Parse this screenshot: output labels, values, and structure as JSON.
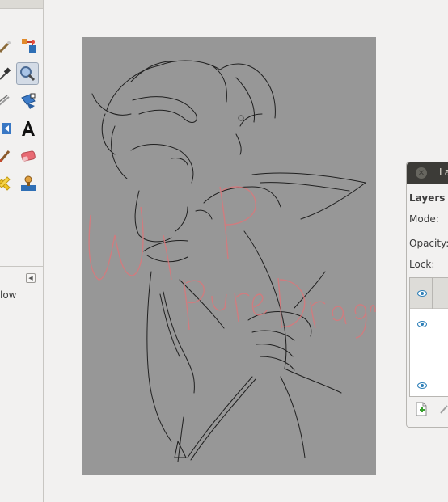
{
  "toolbox": {
    "tools": [
      {
        "name": "measure-tool",
        "icon": "ruler-icon"
      },
      {
        "name": "clone-tool",
        "icon": "clone-stamp-icon"
      },
      {
        "name": "color-picker-tool",
        "icon": "eyedropper-icon"
      },
      {
        "name": "zoom-tool",
        "icon": "magnifier-icon",
        "active": true
      },
      {
        "name": "crop-tool",
        "icon": "knife-icon"
      },
      {
        "name": "transform-tool",
        "icon": "transform-icon"
      },
      {
        "name": "flip-tool",
        "icon": "flip-icon"
      },
      {
        "name": "text-tool",
        "icon": "text-A-icon"
      },
      {
        "name": "paintbrush-tool",
        "icon": "paintbrush-icon"
      },
      {
        "name": "eraser-tool",
        "icon": "eraser-icon"
      },
      {
        "name": "heal-tool",
        "icon": "heal-icon"
      },
      {
        "name": "smudge-tool",
        "icon": "smudge-stamp-icon"
      }
    ],
    "tool_options_partial_text": "low"
  },
  "canvas": {
    "background": "#979797",
    "watermark": "WIP Pure Dragon",
    "watermark_color": "#d9787b"
  },
  "layers_dock": {
    "title_partial": "La",
    "heading": "Layers",
    "mode_label": "Mode:",
    "opacity_label": "Opacity:",
    "lock_label": "Lock:"
  },
  "colors": {
    "titlebar": "#3c3b37",
    "window_bg": "#f2f1f0",
    "selected_row": "#dddcd8",
    "eye_icon": "#2d7fb8"
  }
}
